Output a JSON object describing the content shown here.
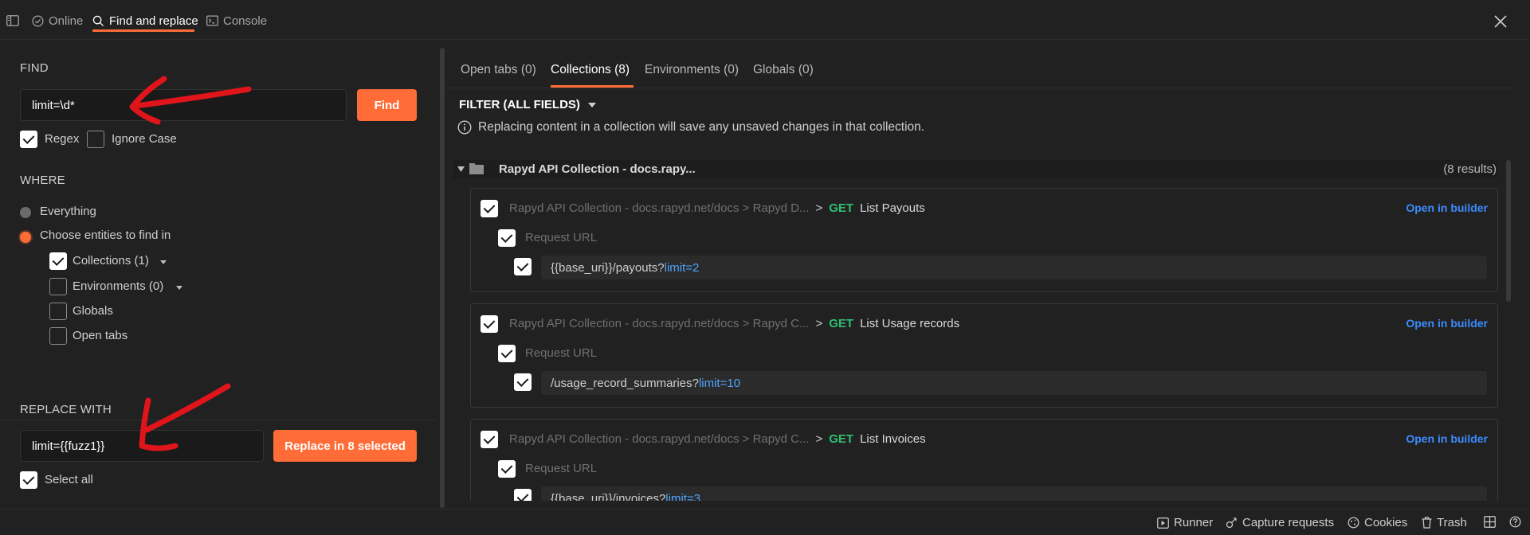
{
  "topbar": {
    "online_label": "Online",
    "find_replace_label": "Find and replace",
    "console_label": "Console"
  },
  "find": {
    "section_label": "FIND",
    "input_value": "limit=\\d*",
    "find_button": "Find",
    "regex_label": "Regex",
    "regex_checked": true,
    "ignore_case_label": "Ignore Case",
    "ignore_case_checked": false
  },
  "where": {
    "section_label": "WHERE",
    "everything_label": "Everything",
    "choose_label": "Choose entities to find in",
    "collections_label": "Collections (1)",
    "environments_label": "Environments (0)",
    "globals_label": "Globals",
    "open_tabs_label": "Open tabs"
  },
  "replace": {
    "section_label": "REPLACE WITH",
    "input_value": "limit={{fuzz1}}",
    "replace_button": "Replace in 8 selected",
    "select_all_label": "Select all"
  },
  "results": {
    "tabs": [
      {
        "label": "Open tabs (0)"
      },
      {
        "label": "Collections (8)"
      },
      {
        "label": "Environments (0)"
      },
      {
        "label": "Globals (0)"
      }
    ],
    "active_tab": 1,
    "filter_label": "FILTER (ALL FIELDS)",
    "info_text": "Replacing content in a collection will save any unsaved changes in that collection.",
    "collection_title": "Rapyd API Collection - docs.rapy...",
    "collection_count": "(8 results)",
    "open_in_builder": "Open in builder",
    "request_url_label": "Request URL",
    "items": [
      {
        "path": "Rapyd API Collection - docs.rapyd.net/docs > Rapyd D...",
        "method": "GET",
        "name": "List Payouts",
        "url_prefix": "{{base_uri}}/payouts?",
        "url_match": "limit=2"
      },
      {
        "path": "Rapyd API Collection - docs.rapyd.net/docs > Rapyd C...",
        "method": "GET",
        "name": "List Usage records",
        "url_prefix": "/usage_record_summaries?",
        "url_match": "limit=10"
      },
      {
        "path": "Rapyd API Collection - docs.rapyd.net/docs > Rapyd C...",
        "method": "GET",
        "name": "List Invoices",
        "url_prefix": "{{base_uri}}/invoices?",
        "url_match": "limit=3"
      }
    ],
    "separator": ">"
  },
  "footer": {
    "runner": "Runner",
    "capture": "Capture requests",
    "cookies": "Cookies",
    "trash": "Trash"
  },
  "colors": {
    "accent": "#ff6c37",
    "method_get": "#2fbf71",
    "link": "#3b8cff",
    "annotation": "#e0151b"
  },
  "icons": [
    "sidebar-toggle-icon",
    "online-check-icon",
    "search-icon",
    "console-icon",
    "close-icon",
    "info-icon",
    "folder-icon",
    "runner-icon",
    "capture-icon",
    "cookies-icon",
    "trash-icon",
    "layout-icon",
    "help-icon"
  ]
}
